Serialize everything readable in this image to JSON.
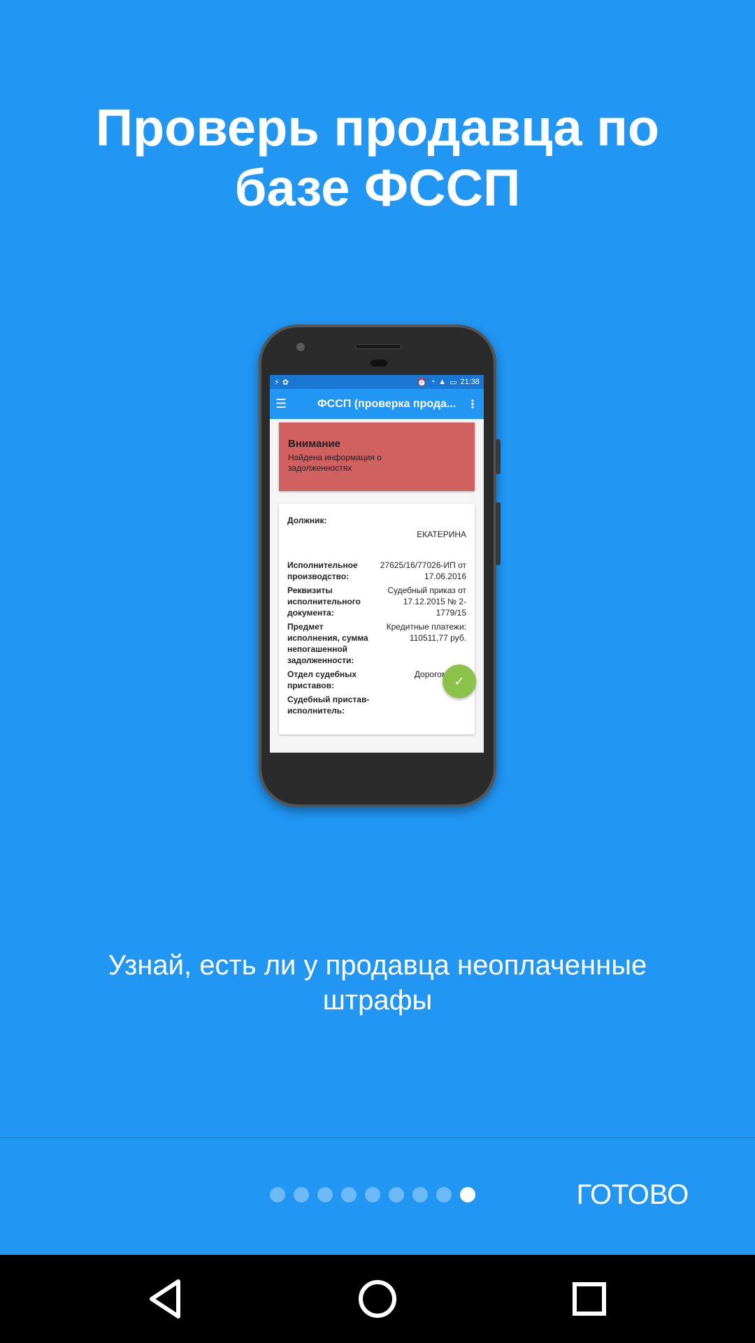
{
  "title": "Проверь продавца по базе ФССП",
  "subtitle": "Узнай, есть ли у продавца неоплаченные штрафы",
  "onboarding": {
    "page_count": 9,
    "active_index": 8,
    "done_label": "ГОТОВО"
  },
  "mockup": {
    "status_time": "21:38",
    "app_title": "ФССП (проверка прода...",
    "alert_heading": "Внимание",
    "alert_text": "Найдена информация о задолженностях",
    "rows": [
      {
        "k": "Должник:",
        "v": ""
      },
      {
        "k": "",
        "v": "ЕКАТЕРИНА"
      },
      {
        "k": "Исполнительное производство:",
        "v": "27625/16/77026-ИП от 17.06.2016"
      },
      {
        "k": "Реквизиты исполнительного документа:",
        "v": "Судебный приказ от 17.12.2015 № 2-1779/15"
      },
      {
        "k": "Предмет исполнения, сумма непогашенной задолженности:",
        "v": "Кредитные платежи: 110511,77 руб."
      },
      {
        "k": "Отдел судебных приставов:",
        "v": "Дорогомилов"
      },
      {
        "k": "Судебный пристав-исполнитель:",
        "v": ""
      }
    ]
  },
  "colors": {
    "background": "#2196f3",
    "alert": "#d16060",
    "fab": "#8bc34a"
  }
}
